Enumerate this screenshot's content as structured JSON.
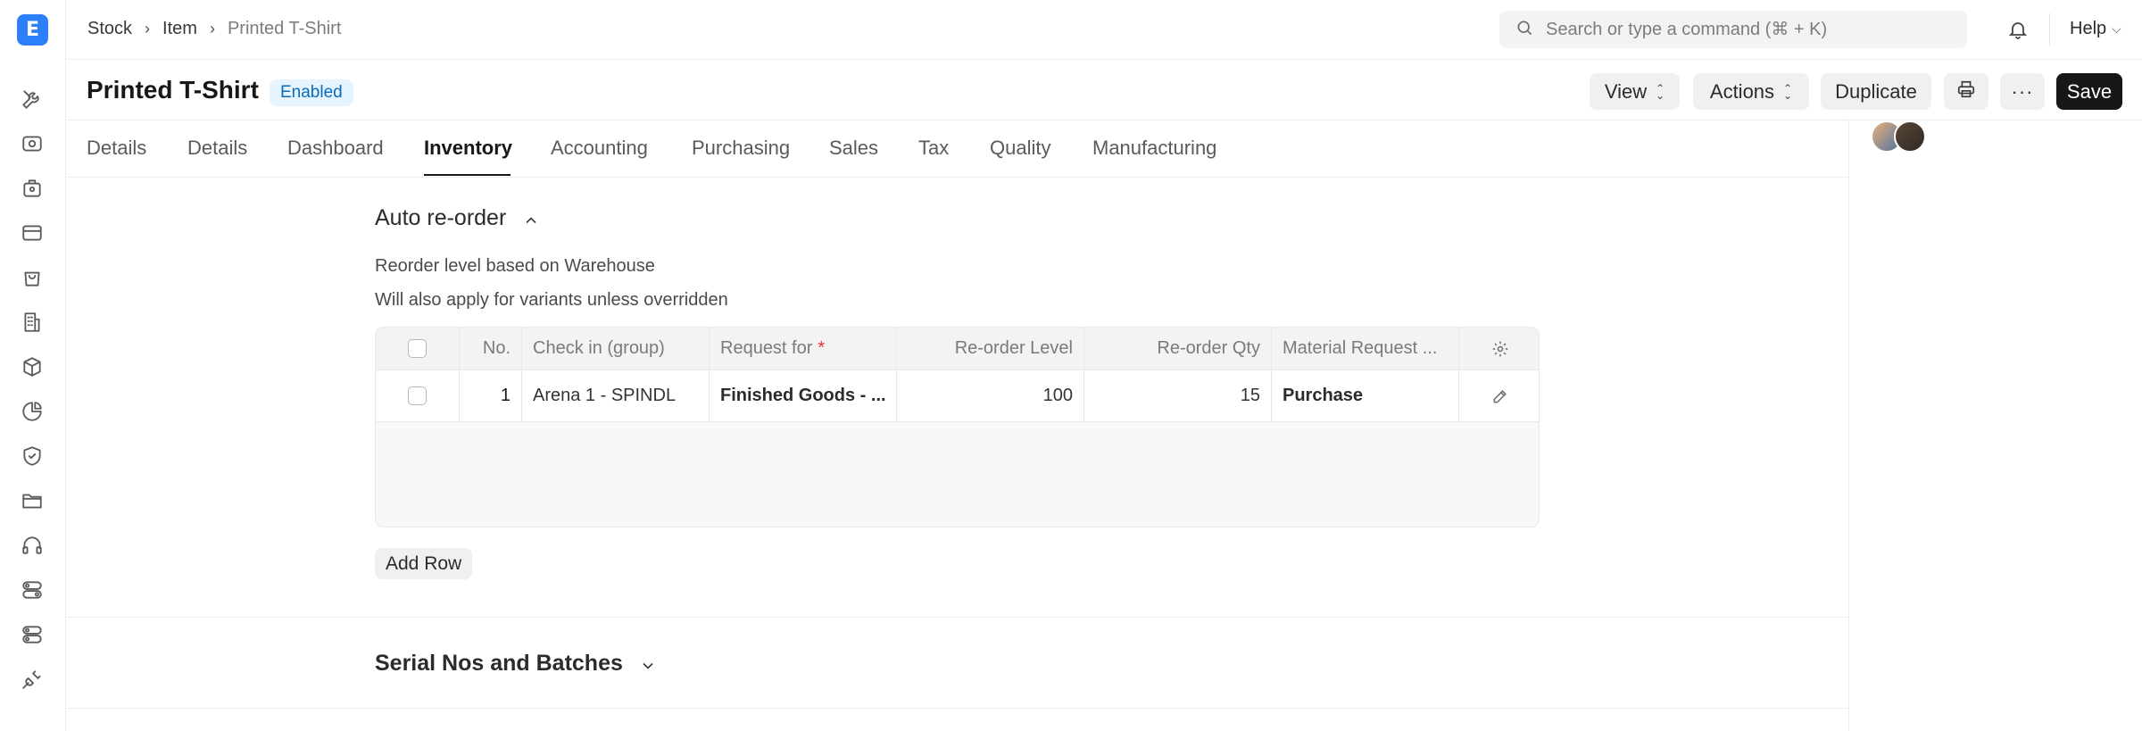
{
  "app": {
    "logo_letter": "E",
    "brand_color": "#2d7ff9"
  },
  "sidebar": {
    "icons": [
      "tools-icon",
      "eye-icon",
      "briefcase-icon",
      "credit-card-icon",
      "shopping-bag-icon",
      "building-icon",
      "package-icon",
      "pie-chart-icon",
      "shield-icon",
      "folder-icon",
      "headset-icon",
      "toggles-icon",
      "toggles-alt-icon",
      "plug-icon"
    ]
  },
  "topbar": {
    "breadcrumb": [
      "Stock",
      "Item",
      "Printed T-Shirt"
    ],
    "search_placeholder": "Search or type a command (⌘ + K)",
    "help_label": "Help"
  },
  "titlebar": {
    "title": "Printed T-Shirt",
    "status": "Enabled",
    "view_label": "View",
    "actions_label": "Actions",
    "duplicate_label": "Duplicate",
    "save_label": "Save"
  },
  "tabs": [
    "Details",
    "Details",
    "Dashboard",
    "Inventory",
    "Accounting",
    "Purchasing",
    "Sales",
    "Tax",
    "Quality",
    "Manufacturing"
  ],
  "active_tab": "Inventory",
  "auto_reorder": {
    "title": "Auto re-order",
    "desc1": "Reorder level based on Warehouse",
    "desc2": "Will also apply for variants unless overridden",
    "columns": {
      "no": "No.",
      "check_in": "Check in (group)",
      "request_for": "Request for",
      "reorder_level": "Re-order Level",
      "reorder_qty": "Re-order Qty",
      "material_request": "Material Request ..."
    },
    "rows": [
      {
        "no": "1",
        "check_in": "Arena 1 - SPINDL",
        "request_for": "Finished Goods - ...",
        "reorder_level": "100",
        "reorder_qty": "15",
        "material_request": "Purchase"
      }
    ],
    "add_row_label": "Add Row"
  },
  "serial_section": {
    "title": "Serial Nos and Batches"
  }
}
